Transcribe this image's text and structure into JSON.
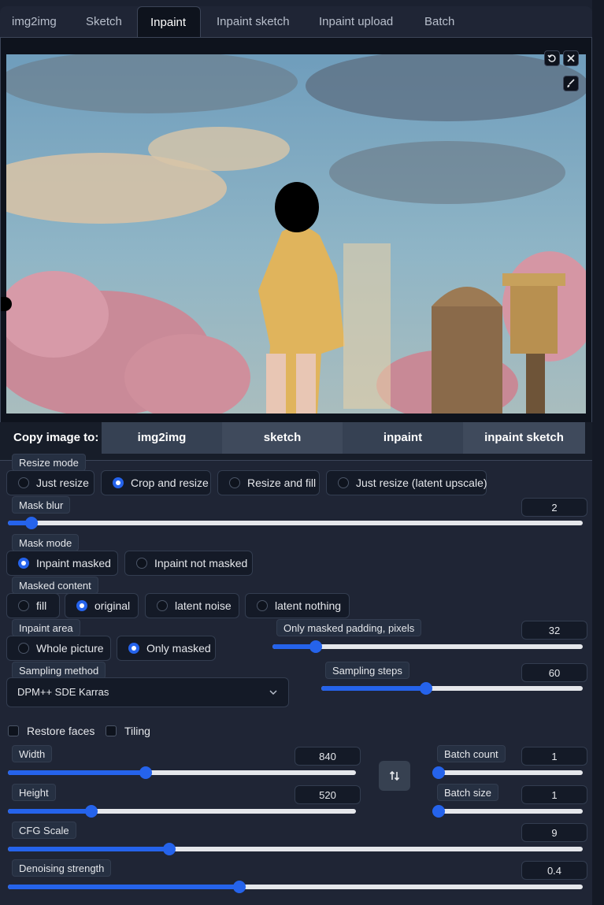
{
  "tabs": [
    {
      "label": "img2img",
      "active": false
    },
    {
      "label": "Sketch",
      "active": false
    },
    {
      "label": "Inpaint",
      "active": true
    },
    {
      "label": "Inpaint sketch",
      "active": false
    },
    {
      "label": "Inpaint upload",
      "active": false
    },
    {
      "label": "Batch",
      "active": false
    }
  ],
  "image_tools": [
    "undo-icon",
    "close-icon",
    "brush-icon"
  ],
  "copy_image_to": {
    "label": "Copy image to:",
    "buttons": [
      "img2img",
      "sketch",
      "inpaint",
      "inpaint sketch"
    ]
  },
  "resize_mode": {
    "label": "Resize mode",
    "options": [
      "Just resize",
      "Crop and resize",
      "Resize and fill",
      "Just resize (latent upscale)"
    ],
    "selected": "Crop and resize"
  },
  "mask_blur": {
    "label": "Mask blur",
    "value": "2",
    "min": 0,
    "max": 64
  },
  "mask_mode": {
    "label": "Mask mode",
    "options": [
      "Inpaint masked",
      "Inpaint not masked"
    ],
    "selected": "Inpaint masked"
  },
  "masked_content": {
    "label": "Masked content",
    "options": [
      "fill",
      "original",
      "latent noise",
      "latent nothing"
    ],
    "selected": "original"
  },
  "inpaint_area": {
    "label": "Inpaint area",
    "options": [
      "Whole picture",
      "Only masked"
    ],
    "selected": "Only masked"
  },
  "only_masked_padding": {
    "label": "Only masked padding, pixels",
    "value": "32",
    "min": 0,
    "max": 256
  },
  "sampling_method": {
    "label": "Sampling method",
    "value": "DPM++ SDE Karras"
  },
  "sampling_steps": {
    "label": "Sampling steps",
    "value": "60",
    "min": 1,
    "max": 150
  },
  "checkboxes": {
    "restore_faces": {
      "label": "Restore faces",
      "checked": false
    },
    "tiling": {
      "label": "Tiling",
      "checked": false
    }
  },
  "width": {
    "label": "Width",
    "value": "840",
    "min": 64,
    "max": 2048
  },
  "height": {
    "label": "Height",
    "value": "520",
    "min": 64,
    "max": 2048
  },
  "batch_count": {
    "label": "Batch count",
    "value": "1",
    "min": 1,
    "max": 100
  },
  "batch_size": {
    "label": "Batch size",
    "value": "1",
    "min": 1,
    "max": 8
  },
  "cfg_scale": {
    "label": "CFG Scale",
    "value": "9",
    "min": 1,
    "max": 30
  },
  "denoising_strength": {
    "label": "Denoising strength",
    "value": "0.4",
    "min": 0,
    "max": 1
  },
  "colors": {
    "accent": "#2563eb",
    "panel": "#1f2535",
    "input_bg": "#141a27"
  }
}
